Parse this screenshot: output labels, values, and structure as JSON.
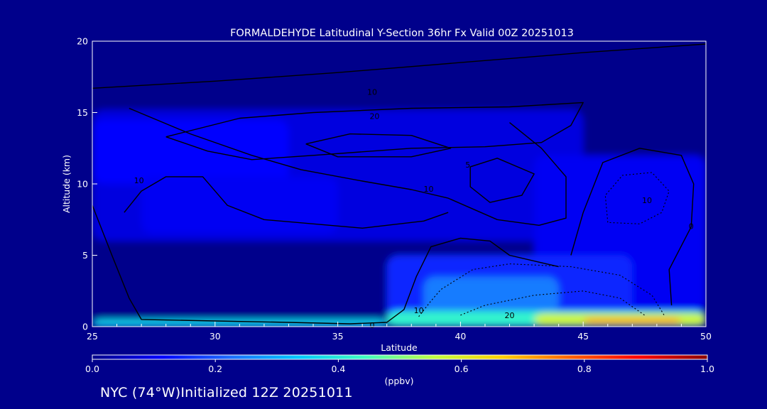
{
  "chart_data": {
    "type": "heatmap",
    "title": "FORMALDEHYDE Latitudinal Y-Section 36hr  Fx Valid 00Z 20251013",
    "xlabel": "Latitude",
    "ylabel": "Altitude (km)",
    "xlim": [
      25,
      50
    ],
    "ylim": [
      0,
      20
    ],
    "x_ticks": [
      "25",
      "30",
      "35",
      "40",
      "45",
      "50"
    ],
    "y_ticks": [
      "0",
      "5",
      "10",
      "15",
      "20"
    ],
    "x_tick_values": [
      25,
      30,
      35,
      40,
      45,
      50
    ],
    "y_tick_values": [
      0,
      5,
      10,
      15,
      20
    ],
    "grid": false,
    "colorbar": {
      "min": 0.0,
      "max": 1.0,
      "ticks": [
        "0.0",
        "0.2",
        "0.4",
        "0.6",
        "0.8",
        "1.0"
      ],
      "tick_values": [
        0,
        0.2,
        0.4,
        0.6,
        0.8,
        1.0
      ],
      "unit": "(ppbv)",
      "colors": [
        "#00008b",
        "#0000ff",
        "#1e6cff",
        "#00c8ff",
        "#40ffc0",
        "#c0ff40",
        "#ffd000",
        "#ff6000",
        "#ff0000",
        "#8b0000"
      ]
    },
    "fields": [
      {
        "x0": 25,
        "x1": 50,
        "y0": 0,
        "y1": 20,
        "value": 0.0
      },
      {
        "x0": 25,
        "x1": 45,
        "y0": 6,
        "y1": 15.2,
        "value": 0.08
      },
      {
        "x0": 25,
        "x1": 33,
        "y0": 10,
        "y1": 14.5,
        "value": 0.11
      },
      {
        "x0": 27,
        "x1": 35,
        "y0": 6.5,
        "y1": 10.5,
        "value": 0.1
      },
      {
        "x0": 43,
        "x1": 50,
        "y0": 1,
        "y1": 12,
        "value": 0.1
      },
      {
        "x0": 37,
        "x1": 47,
        "y0": 0.5,
        "y1": 5,
        "value": 0.15
      },
      {
        "x0": 38.5,
        "x1": 44,
        "y0": 0.8,
        "y1": 3.5,
        "value": 0.24
      },
      {
        "x0": 25,
        "x1": 37,
        "y0": 0,
        "y1": 0.5,
        "value": 0.36
      },
      {
        "x0": 37,
        "x1": 50,
        "y0": 0,
        "y1": 1.1,
        "value": 0.42
      },
      {
        "x0": 43,
        "x1": 50,
        "y0": 0.1,
        "y1": 0.9,
        "value": 0.58
      },
      {
        "x0": 45,
        "x1": 49,
        "y0": 0.2,
        "y1": 0.6,
        "value": 0.72
      }
    ],
    "contours": [
      {
        "label": "10",
        "label_x": 36.4,
        "label_y": 16.4,
        "style": "solid",
        "points": [
          [
            25,
            16.7
          ],
          [
            30,
            17.2
          ],
          [
            35,
            17.8
          ],
          [
            40,
            18.5
          ],
          [
            45,
            19.2
          ],
          [
            50,
            19.8
          ]
        ]
      },
      {
        "label": "20",
        "label_x": 36.5,
        "label_y": 14.7,
        "style": "solid",
        "points": [
          [
            28,
            13.3
          ],
          [
            31,
            14.6
          ],
          [
            34,
            15
          ],
          [
            38,
            15.3
          ],
          [
            42,
            15.4
          ],
          [
            45,
            15.7
          ],
          [
            44.5,
            14.1
          ],
          [
            43.3,
            12.9
          ],
          [
            41,
            12.6
          ],
          [
            38,
            12.5
          ],
          [
            34,
            12
          ],
          [
            31.5,
            11.7
          ],
          [
            29.7,
            12.3
          ],
          [
            28,
            13.3
          ]
        ]
      },
      {
        "label": "",
        "label_x": 0,
        "label_y": 0,
        "style": "solid",
        "points": [
          [
            33.7,
            12.8
          ],
          [
            35.5,
            13.5
          ],
          [
            38,
            13.4
          ],
          [
            39.6,
            12.5
          ],
          [
            38,
            11.9
          ],
          [
            35,
            11.9
          ],
          [
            33.7,
            12.8
          ]
        ]
      },
      {
        "label": "10",
        "label_x": 38.7,
        "label_y": 9.6,
        "style": "solid",
        "points": [
          [
            26.5,
            15.3
          ],
          [
            29,
            13.5
          ],
          [
            31.5,
            12
          ],
          [
            33.5,
            11
          ],
          [
            36,
            10.2
          ],
          [
            38,
            9.6
          ],
          [
            39.5,
            9
          ],
          [
            41.5,
            7.5
          ],
          [
            43.2,
            7.1
          ],
          [
            44.3,
            7.6
          ],
          [
            44.3,
            10.5
          ],
          [
            43.3,
            12.5
          ],
          [
            42,
            14.3
          ]
        ]
      },
      {
        "label": "10",
        "label_x": 26.9,
        "label_y": 10.2,
        "style": "solid",
        "points": [
          [
            26.3,
            8
          ],
          [
            27,
            9.5
          ],
          [
            28,
            10.5
          ],
          [
            29.5,
            10.5
          ],
          [
            30.5,
            8.5
          ],
          [
            32,
            7.5
          ],
          [
            36,
            6.9
          ],
          [
            38.5,
            7.4
          ],
          [
            39.5,
            8
          ]
        ]
      },
      {
        "label": "0",
        "label_x": 36.4,
        "label_y": 0.05,
        "style": "solid",
        "points": [
          [
            25,
            8.5
          ],
          [
            25.8,
            5
          ],
          [
            26.5,
            2
          ],
          [
            27,
            0.5
          ],
          [
            30,
            0.4
          ],
          [
            33,
            0.3
          ],
          [
            35.5,
            0.2
          ],
          [
            37,
            0.3
          ],
          [
            37.7,
            1.2
          ],
          [
            38.2,
            3.5
          ],
          [
            38.8,
            5.6
          ],
          [
            40,
            6.2
          ],
          [
            41.2,
            6
          ],
          [
            42,
            5
          ],
          [
            44,
            4.2
          ]
        ]
      },
      {
        "label": "5",
        "label_x": 40.3,
        "label_y": 11.3,
        "style": "solid",
        "points": [
          [
            40.4,
            11.2
          ],
          [
            41.5,
            11.8
          ],
          [
            43,
            10.7
          ],
          [
            42.5,
            9.2
          ],
          [
            41.2,
            8.7
          ],
          [
            40.4,
            9.8
          ],
          [
            40.4,
            11.2
          ]
        ]
      },
      {
        "label": "0",
        "label_x": 49.4,
        "label_y": 7,
        "style": "solid",
        "points": [
          [
            44.5,
            5
          ],
          [
            45,
            8
          ],
          [
            45.8,
            11.5
          ],
          [
            47.3,
            12.5
          ],
          [
            49,
            12
          ],
          [
            49.5,
            10
          ],
          [
            49.4,
            7
          ],
          [
            48.5,
            4
          ],
          [
            48.6,
            1.5
          ]
        ]
      },
      {
        "label": "10",
        "label_x": 38.3,
        "label_y": 1.1,
        "style": "dotted",
        "points": [
          [
            38.3,
            0.7
          ],
          [
            38.8,
            1.8
          ],
          [
            39.2,
            2.6
          ],
          [
            40.5,
            4
          ],
          [
            42,
            4.4
          ],
          [
            44.5,
            4.2
          ],
          [
            46.5,
            3.6
          ],
          [
            47.8,
            2.2
          ],
          [
            48.3,
            0.8
          ]
        ]
      },
      {
        "label": "20",
        "label_x": 42,
        "label_y": 0.75,
        "style": "dotted",
        "points": [
          [
            40,
            0.8
          ],
          [
            41,
            1.5
          ],
          [
            43,
            2.2
          ],
          [
            45,
            2.5
          ],
          [
            46.5,
            2
          ],
          [
            47.5,
            0.8
          ]
        ]
      },
      {
        "label": "10",
        "label_x": 47.6,
        "label_y": 8.8,
        "style": "dotted",
        "points": [
          [
            46,
            7.3
          ],
          [
            45.9,
            9.2
          ],
          [
            46.6,
            10.6
          ],
          [
            47.8,
            10.8
          ],
          [
            48.5,
            9.5
          ],
          [
            48.2,
            8
          ],
          [
            47.3,
            7.2
          ],
          [
            46,
            7.3
          ]
        ]
      }
    ],
    "footer": "NYC (74°W)Initialized 12Z 20251011"
  }
}
